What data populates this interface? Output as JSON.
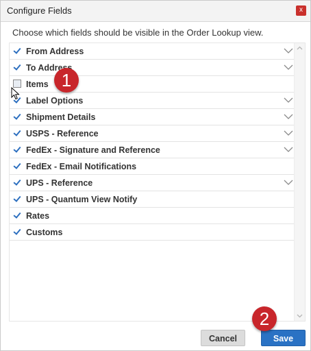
{
  "dialog": {
    "title": "Configure Fields",
    "close_label": "x",
    "instruction": "Choose which fields should be visible in the Order Lookup view."
  },
  "fields": [
    {
      "label": "From Address",
      "checked": true,
      "expandable": true
    },
    {
      "label": "To Address",
      "checked": true,
      "expandable": true
    },
    {
      "label": "Items",
      "checked": false,
      "expandable": false
    },
    {
      "label": "Label Options",
      "checked": true,
      "expandable": true
    },
    {
      "label": "Shipment Details",
      "checked": true,
      "expandable": true
    },
    {
      "label": "USPS - Reference",
      "checked": true,
      "expandable": true
    },
    {
      "label": "FedEx - Signature and Reference",
      "checked": true,
      "expandable": true
    },
    {
      "label": "FedEx - Email Notifications",
      "checked": true,
      "expandable": false
    },
    {
      "label": "UPS - Reference",
      "checked": true,
      "expandable": true
    },
    {
      "label": "UPS - Quantum View Notify",
      "checked": true,
      "expandable": false
    },
    {
      "label": "Rates",
      "checked": true,
      "expandable": false
    },
    {
      "label": "Customs",
      "checked": true,
      "expandable": false
    }
  ],
  "buttons": {
    "cancel": "Cancel",
    "save": "Save"
  },
  "badges": {
    "step1": "1",
    "step2": "2"
  },
  "colors": {
    "accent": "#2a72c4",
    "badge": "#c8262b",
    "close": "#c9302c"
  }
}
